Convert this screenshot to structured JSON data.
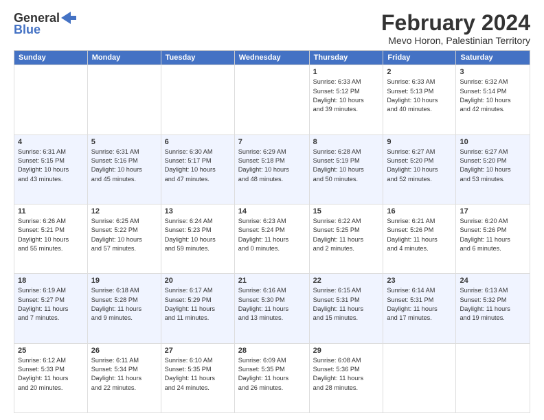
{
  "header": {
    "logo_general": "General",
    "logo_blue": "Blue",
    "month_title": "February 2024",
    "location": "Mevo Horon, Palestinian Territory"
  },
  "days_of_week": [
    "Sunday",
    "Monday",
    "Tuesday",
    "Wednesday",
    "Thursday",
    "Friday",
    "Saturday"
  ],
  "weeks": [
    [
      {
        "day": "",
        "info": ""
      },
      {
        "day": "",
        "info": ""
      },
      {
        "day": "",
        "info": ""
      },
      {
        "day": "",
        "info": ""
      },
      {
        "day": "1",
        "info": "Sunrise: 6:33 AM\nSunset: 5:12 PM\nDaylight: 10 hours\nand 39 minutes."
      },
      {
        "day": "2",
        "info": "Sunrise: 6:33 AM\nSunset: 5:13 PM\nDaylight: 10 hours\nand 40 minutes."
      },
      {
        "day": "3",
        "info": "Sunrise: 6:32 AM\nSunset: 5:14 PM\nDaylight: 10 hours\nand 42 minutes."
      }
    ],
    [
      {
        "day": "4",
        "info": "Sunrise: 6:31 AM\nSunset: 5:15 PM\nDaylight: 10 hours\nand 43 minutes."
      },
      {
        "day": "5",
        "info": "Sunrise: 6:31 AM\nSunset: 5:16 PM\nDaylight: 10 hours\nand 45 minutes."
      },
      {
        "day": "6",
        "info": "Sunrise: 6:30 AM\nSunset: 5:17 PM\nDaylight: 10 hours\nand 47 minutes."
      },
      {
        "day": "7",
        "info": "Sunrise: 6:29 AM\nSunset: 5:18 PM\nDaylight: 10 hours\nand 48 minutes."
      },
      {
        "day": "8",
        "info": "Sunrise: 6:28 AM\nSunset: 5:19 PM\nDaylight: 10 hours\nand 50 minutes."
      },
      {
        "day": "9",
        "info": "Sunrise: 6:27 AM\nSunset: 5:20 PM\nDaylight: 10 hours\nand 52 minutes."
      },
      {
        "day": "10",
        "info": "Sunrise: 6:27 AM\nSunset: 5:20 PM\nDaylight: 10 hours\nand 53 minutes."
      }
    ],
    [
      {
        "day": "11",
        "info": "Sunrise: 6:26 AM\nSunset: 5:21 PM\nDaylight: 10 hours\nand 55 minutes."
      },
      {
        "day": "12",
        "info": "Sunrise: 6:25 AM\nSunset: 5:22 PM\nDaylight: 10 hours\nand 57 minutes."
      },
      {
        "day": "13",
        "info": "Sunrise: 6:24 AM\nSunset: 5:23 PM\nDaylight: 10 hours\nand 59 minutes."
      },
      {
        "day": "14",
        "info": "Sunrise: 6:23 AM\nSunset: 5:24 PM\nDaylight: 11 hours\nand 0 minutes."
      },
      {
        "day": "15",
        "info": "Sunrise: 6:22 AM\nSunset: 5:25 PM\nDaylight: 11 hours\nand 2 minutes."
      },
      {
        "day": "16",
        "info": "Sunrise: 6:21 AM\nSunset: 5:26 PM\nDaylight: 11 hours\nand 4 minutes."
      },
      {
        "day": "17",
        "info": "Sunrise: 6:20 AM\nSunset: 5:26 PM\nDaylight: 11 hours\nand 6 minutes."
      }
    ],
    [
      {
        "day": "18",
        "info": "Sunrise: 6:19 AM\nSunset: 5:27 PM\nDaylight: 11 hours\nand 7 minutes."
      },
      {
        "day": "19",
        "info": "Sunrise: 6:18 AM\nSunset: 5:28 PM\nDaylight: 11 hours\nand 9 minutes."
      },
      {
        "day": "20",
        "info": "Sunrise: 6:17 AM\nSunset: 5:29 PM\nDaylight: 11 hours\nand 11 minutes."
      },
      {
        "day": "21",
        "info": "Sunrise: 6:16 AM\nSunset: 5:30 PM\nDaylight: 11 hours\nand 13 minutes."
      },
      {
        "day": "22",
        "info": "Sunrise: 6:15 AM\nSunset: 5:31 PM\nDaylight: 11 hours\nand 15 minutes."
      },
      {
        "day": "23",
        "info": "Sunrise: 6:14 AM\nSunset: 5:31 PM\nDaylight: 11 hours\nand 17 minutes."
      },
      {
        "day": "24",
        "info": "Sunrise: 6:13 AM\nSunset: 5:32 PM\nDaylight: 11 hours\nand 19 minutes."
      }
    ],
    [
      {
        "day": "25",
        "info": "Sunrise: 6:12 AM\nSunset: 5:33 PM\nDaylight: 11 hours\nand 20 minutes."
      },
      {
        "day": "26",
        "info": "Sunrise: 6:11 AM\nSunset: 5:34 PM\nDaylight: 11 hours\nand 22 minutes."
      },
      {
        "day": "27",
        "info": "Sunrise: 6:10 AM\nSunset: 5:35 PM\nDaylight: 11 hours\nand 24 minutes."
      },
      {
        "day": "28",
        "info": "Sunrise: 6:09 AM\nSunset: 5:35 PM\nDaylight: 11 hours\nand 26 minutes."
      },
      {
        "day": "29",
        "info": "Sunrise: 6:08 AM\nSunset: 5:36 PM\nDaylight: 11 hours\nand 28 minutes."
      },
      {
        "day": "",
        "info": ""
      },
      {
        "day": "",
        "info": ""
      }
    ]
  ]
}
